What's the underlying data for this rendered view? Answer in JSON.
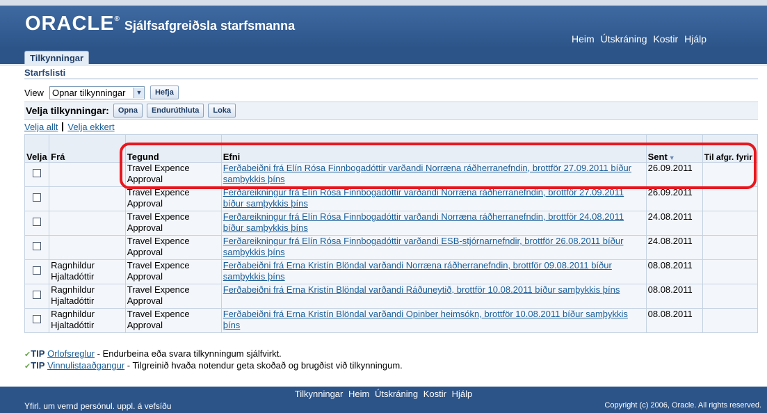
{
  "header": {
    "logo": "ORACLE",
    "app_title": "Sjálfsafgreiðsla starfsmanna",
    "global_nav": [
      "Heim",
      "Útskráning",
      "Kostir",
      "Hjálp"
    ]
  },
  "tab": {
    "label": "Tilkynningar"
  },
  "section": {
    "title": "Starfslisti"
  },
  "view": {
    "label": "View",
    "selected": "Opnar tilkynningar",
    "go_button": "Hefja"
  },
  "actions": {
    "label": "Velja tilkynningar:",
    "buttons": [
      "Opna",
      "Endurúthluta",
      "Loka"
    ]
  },
  "selection": {
    "select_all": "Velja allt",
    "select_none": "Velja ekkert"
  },
  "table": {
    "headers": {
      "select": "Velja",
      "from": "Frá",
      "type": "Tegund",
      "subject": "Efni",
      "sent": "Sent",
      "due": "Til afgr. fyrir"
    },
    "rows": [
      {
        "from": "",
        "type": "Travel Expence Approval",
        "subject": "Ferðabeiðni frá Elín Rósa Finnbogadóttir varðandi Norræna ráðherranefndin, brottför 27.09.2011 bíður samþykkis þíns",
        "sent": "26.09.2011",
        "due": ""
      },
      {
        "from": "",
        "type": "Travel Expence Approval",
        "subject": "Ferðareikningur frá Elín Rósa Finnbogadóttir varðandi Norræna ráðherranefndin, brottför 27.09.2011 bíður samþykkis þíns",
        "sent": "26.09.2011",
        "due": ""
      },
      {
        "from": "",
        "type": "Travel Expence Approval",
        "subject": "Ferðareikningur frá Elín Rósa Finnbogadóttir varðandi Norræna ráðherranefndin, brottför 24.08.2011 bíður samþykkis þíns",
        "sent": "24.08.2011",
        "due": ""
      },
      {
        "from": "",
        "type": "Travel Expence Approval",
        "subject": "Ferðareikningur frá Elín Rósa Finnbogadóttir varðandi ESB-stjórnarnefndir, brottför 26.08.2011 bíður samþykkis þíns",
        "sent": "24.08.2011",
        "due": ""
      },
      {
        "from": "Ragnhildur Hjaltadóttir",
        "type": "Travel Expence Approval",
        "subject": "Ferðabeiðni frá Erna Kristín Blöndal varðandi Norræna ráðherranefndin, brottför 09.08.2011 bíður samþykkis þíns",
        "sent": "08.08.2011",
        "due": ""
      },
      {
        "from": "Ragnhildur Hjaltadóttir",
        "type": "Travel Expence Approval",
        "subject": "Ferðabeiðni frá Erna Kristín Blöndal varðandi Ráðuneytið, brottför 10.08.2011 bíður samþykkis þíns",
        "sent": "08.08.2011",
        "due": ""
      },
      {
        "from": "Ragnhildur Hjaltadóttir",
        "type": "Travel Expence Approval",
        "subject": "Ferðabeiðni frá Erna Kristín Blöndal varðandi Opinber heimsókn, brottför 10.08.2011 bíður samþykkis þíns",
        "sent": "08.08.2011",
        "due": ""
      }
    ]
  },
  "tips": [
    {
      "label": "TIP",
      "link": "Orlofsreglur",
      "text": " - Endurbeina eða svara tilkynningum sjálfvirkt."
    },
    {
      "label": "TIP",
      "link": "Vinnulistaaðgangur",
      "text": " - Tilgreinið hvaða notendur geta skoðað og brugðist við tilkynningum."
    }
  ],
  "footer": {
    "nav": [
      "Tilkynningar",
      "Heim",
      "Útskráning",
      "Kostir",
      "Hjálp"
    ],
    "privacy": "Yfirl. um vernd persónul. uppl. á vefsíðu",
    "copyright": "Copyright (c) 2006, Oracle. All rights reserved."
  },
  "colors": {
    "header_blue": "#2c5489",
    "link": "#1a5e9a",
    "highlight": "#e8171e"
  }
}
